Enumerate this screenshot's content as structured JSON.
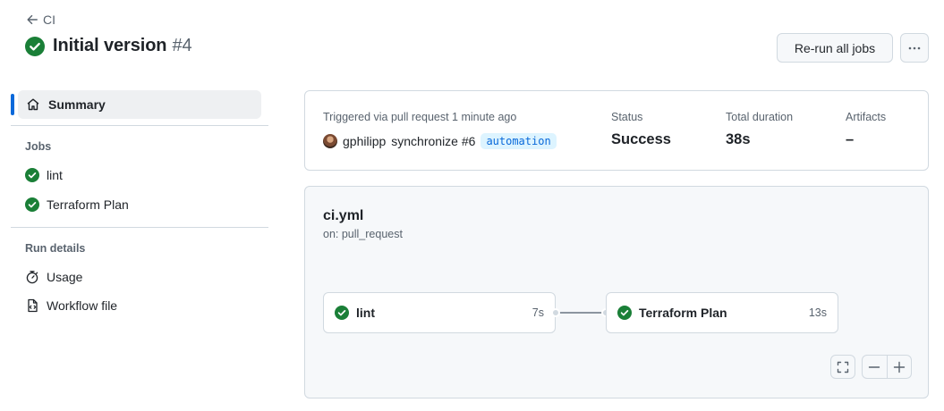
{
  "header": {
    "back_label": "CI",
    "title": "Initial version",
    "run_number": "#4",
    "rerun_label": "Re-run all jobs"
  },
  "sidebar": {
    "summary_label": "Summary",
    "jobs_heading": "Jobs",
    "jobs": [
      {
        "label": "lint",
        "status": "success"
      },
      {
        "label": "Terraform Plan",
        "status": "success"
      }
    ],
    "run_details_heading": "Run details",
    "run_details": [
      {
        "label": "Usage",
        "icon": "stopwatch-icon"
      },
      {
        "label": "Workflow file",
        "icon": "file-code-icon"
      }
    ]
  },
  "summary": {
    "trigger_text": "Triggered via pull request 1 minute ago",
    "user": "gphilipp",
    "action": "synchronize #6",
    "label": "automation",
    "status_label": "Status",
    "status_value": "Success",
    "duration_label": "Total duration",
    "duration_value": "38s",
    "artifacts_label": "Artifacts",
    "artifacts_value": "–"
  },
  "workflow": {
    "file": "ci.yml",
    "trigger": "on: pull_request",
    "jobs": [
      {
        "name": "lint",
        "duration": "7s"
      },
      {
        "name": "Terraform Plan",
        "duration": "13s"
      }
    ]
  },
  "colors": {
    "success": "#1a7f37",
    "accent": "#0969da",
    "border": "#d1d9e0",
    "muted": "#59636e"
  }
}
